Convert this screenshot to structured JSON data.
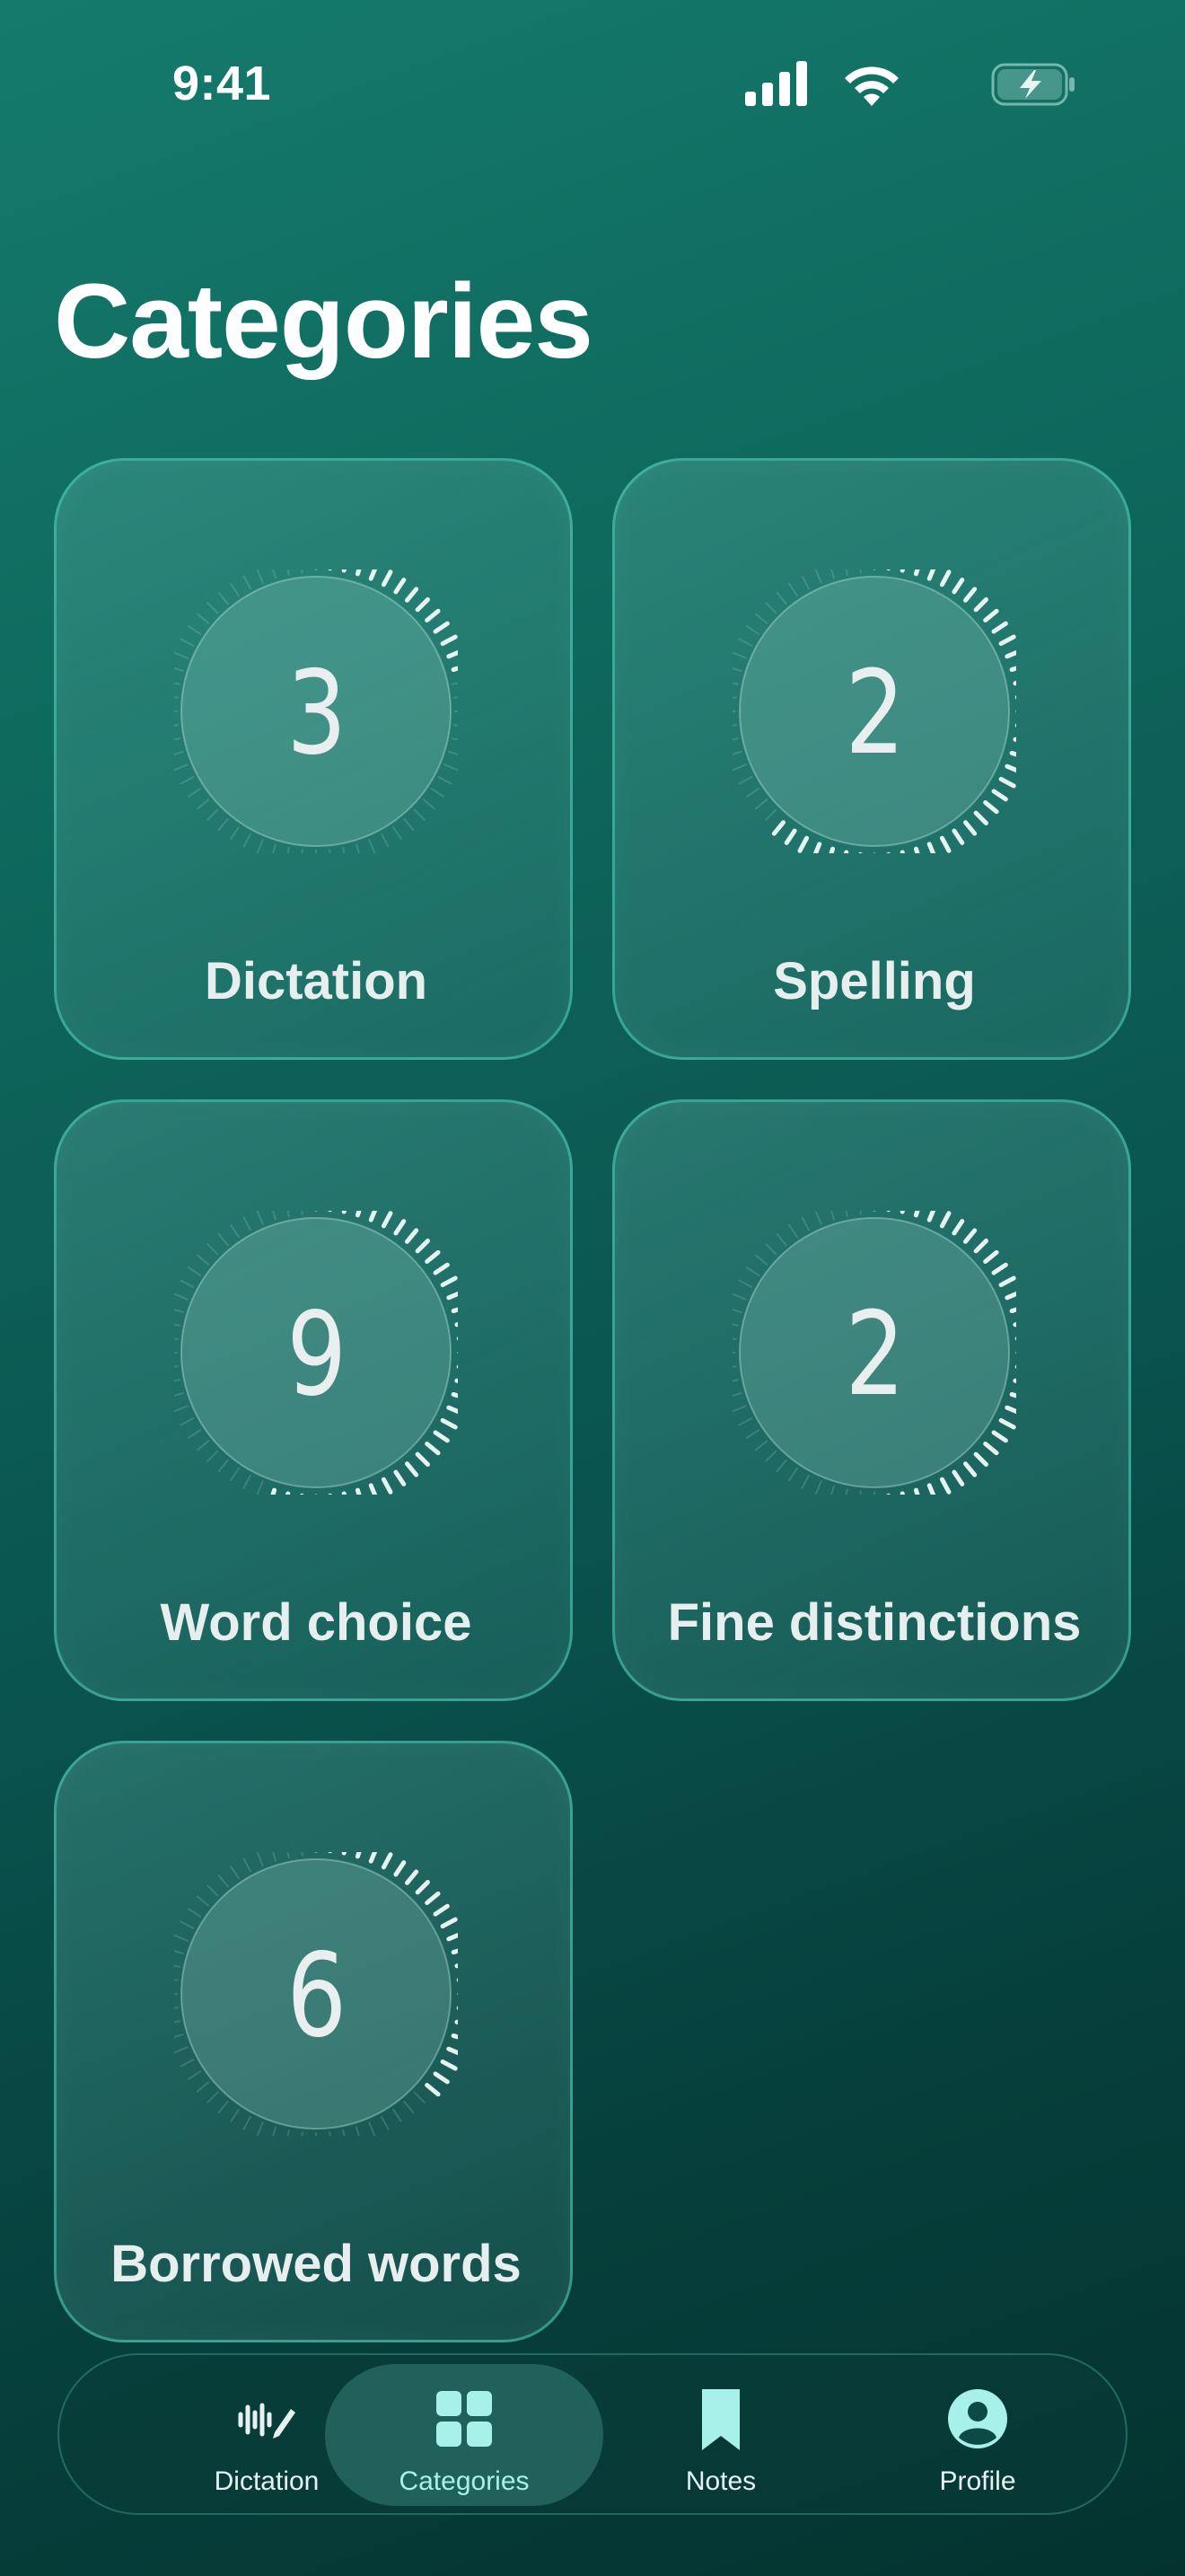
{
  "status_bar": {
    "time": "9:41",
    "icons": [
      "cellular-signal-icon",
      "wifi-icon",
      "battery-charging-icon"
    ]
  },
  "page": {
    "title": "Categories"
  },
  "categories": [
    {
      "label": "Dictation",
      "count": "3",
      "progress": 0.22
    },
    {
      "label": "Spelling",
      "count": "2",
      "progress": 0.63
    },
    {
      "label": "Word choice",
      "count": "9",
      "progress": 0.56
    },
    {
      "label": "Fine distinctions",
      "count": "2",
      "progress": 0.5
    },
    {
      "label": "Borrowed words",
      "count": "6",
      "progress": 0.37
    }
  ],
  "tab_bar": {
    "selected": "Categories",
    "items": [
      {
        "label": "Dictation",
        "icon": "waveform-pencil-icon"
      },
      {
        "label": "Categories",
        "icon": "grid-icon"
      },
      {
        "label": "Notes",
        "icon": "bookmark-icon"
      },
      {
        "label": "Profile",
        "icon": "person-circle-icon"
      }
    ]
  },
  "colors": {
    "background_top": "#147a6c",
    "background_bottom": "#04332f",
    "card_border": "#50d2be",
    "active_tab_text": "#a7f1ea"
  }
}
